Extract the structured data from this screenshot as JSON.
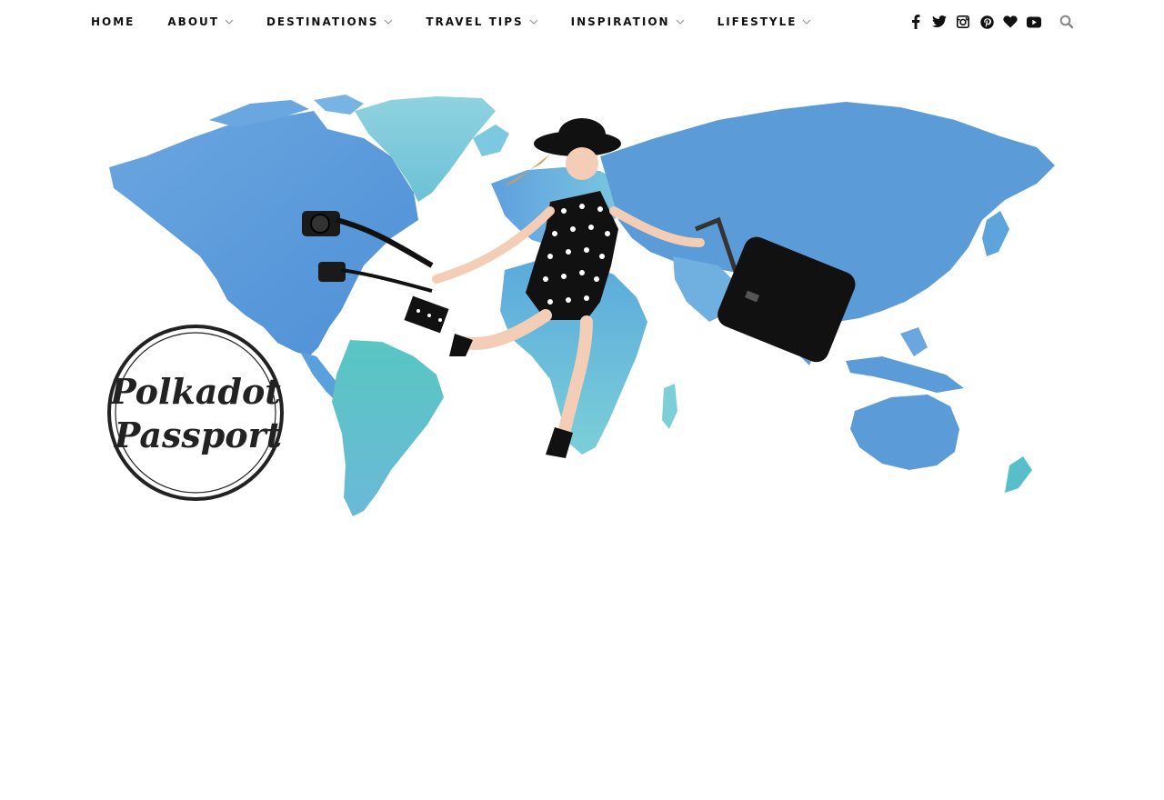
{
  "nav": {
    "items": [
      {
        "label": "HOME",
        "has_dropdown": false
      },
      {
        "label": "ABOUT",
        "has_dropdown": true
      },
      {
        "label": "DESTINATIONS",
        "has_dropdown": true
      },
      {
        "label": "TRAVEL TIPS",
        "has_dropdown": true
      },
      {
        "label": "INSPIRATION",
        "has_dropdown": true
      },
      {
        "label": "LIFESTYLE",
        "has_dropdown": true
      }
    ],
    "social_icons": [
      "facebook-icon",
      "twitter-icon",
      "instagram-icon",
      "pinterest-icon",
      "bloglovin-heart-icon",
      "youtube-icon"
    ],
    "search_icon": "search-icon"
  },
  "hero": {
    "logo_line1": "Polkadot",
    "logo_line2": "Passport"
  },
  "colors": {
    "text": "#111111",
    "chevron": "#999999",
    "search": "#888888",
    "map_blue": "#5b9bd8",
    "map_teal": "#55c3c6",
    "logo": "#222222"
  }
}
